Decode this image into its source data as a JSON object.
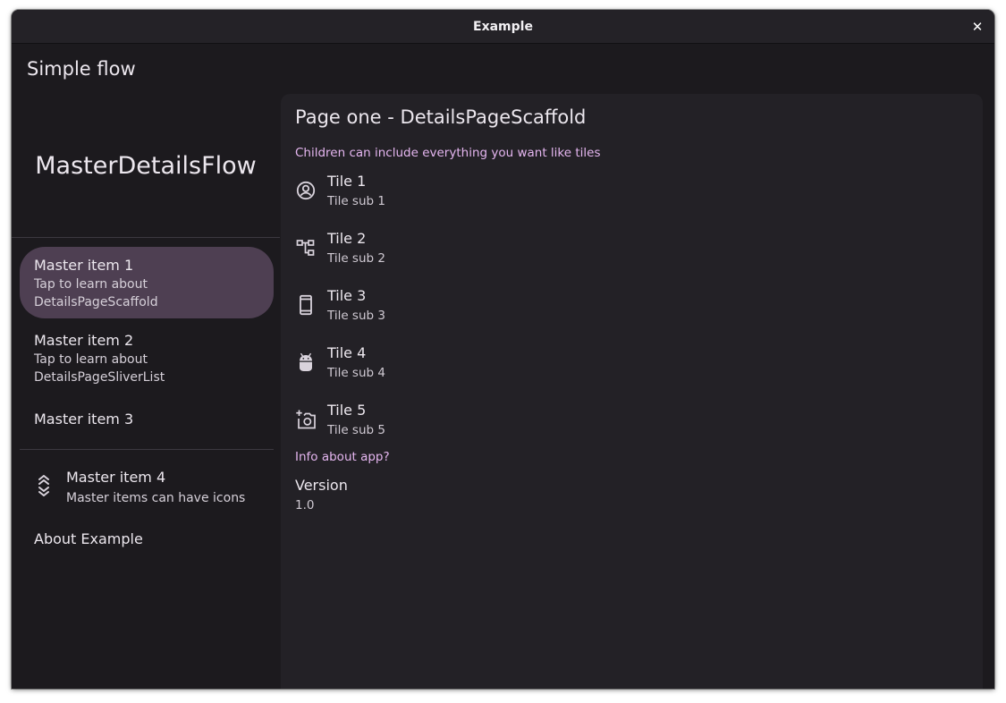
{
  "window": {
    "title": "Example",
    "close_glyph": "✕"
  },
  "appbar": {
    "title": "Simple flow"
  },
  "master": {
    "header": "MasterDetailsFlow",
    "items": [
      {
        "title": "Master item 1",
        "subtitle_line1": "Tap to learn about",
        "subtitle_line2": "DetailsPageScaffold",
        "selected": true
      },
      {
        "title": "Master item 2",
        "subtitle_line1": "Tap to learn about",
        "subtitle_line2": "DetailsPageSliverList",
        "selected": false
      },
      {
        "title": "Master item 3",
        "selected": false
      },
      {
        "title": "Master item 4",
        "subtitle": "Master items can have icons",
        "icon": "double-chevron-icon",
        "selected": false
      },
      {
        "title": "About Example",
        "selected": false
      }
    ]
  },
  "details": {
    "title": "Page one - DetailsPageScaffold",
    "section1": "Children can include everything you want like tiles",
    "tiles": [
      {
        "title": "Tile 1",
        "subtitle": "Tile sub 1",
        "icon": "account-circle-icon"
      },
      {
        "title": "Tile 2",
        "subtitle": "Tile sub 2",
        "icon": "account-tree-icon"
      },
      {
        "title": "Tile 3",
        "subtitle": "Tile sub 3",
        "icon": "smartphone-icon"
      },
      {
        "title": "Tile 4",
        "subtitle": "Tile sub 4",
        "icon": "android-icon"
      },
      {
        "title": "Tile 5",
        "subtitle": "Tile sub 5",
        "icon": "add-a-photo-icon"
      }
    ],
    "section2": "Info about app?",
    "version": {
      "label": "Version",
      "value": "1.0"
    }
  },
  "colors": {
    "background": "#1c1a1e",
    "surface": "#232126",
    "selected": "#4e3f52",
    "accent": "#e5b6f0",
    "text": "#ece7ee"
  }
}
